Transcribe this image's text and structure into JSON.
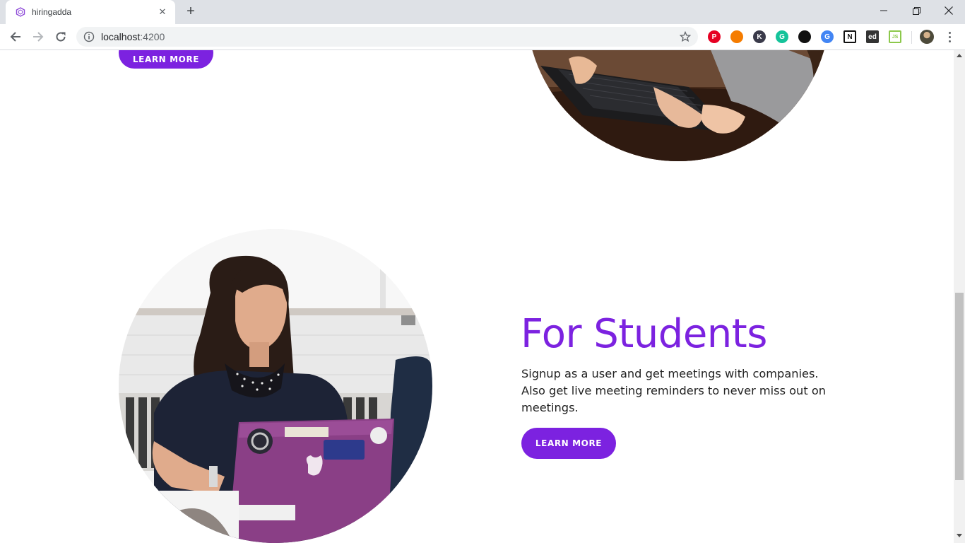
{
  "browser": {
    "tab_title": "hiringadda",
    "url_host": "localhost",
    "url_port": ":4200",
    "extensions": [
      {
        "name": "pinterest-extension-icon",
        "color": "#e60023",
        "letter": "P"
      },
      {
        "name": "orange-blue-extension-icon",
        "color": "#f57c00",
        "letter": ""
      },
      {
        "name": "k-extension-icon",
        "color": "#3a3a4a",
        "letter": "K"
      },
      {
        "name": "grammarly-extension-icon",
        "color": "#15c39a",
        "letter": "G"
      },
      {
        "name": "bird-extension-icon",
        "color": "#111111",
        "letter": ""
      },
      {
        "name": "google-translate-extension-icon",
        "color": "#4285f4",
        "letter": "G"
      },
      {
        "name": "notion-extension-icon",
        "color": "#111111",
        "letter": "N"
      },
      {
        "name": "ed-extension-icon",
        "color": "#333333",
        "letter": "ed"
      },
      {
        "name": "nodejs-extension-icon",
        "color": "#8cc84b",
        "letter": "JS"
      }
    ]
  },
  "page": {
    "top_section": {
      "learn_more_label": "LEARN MORE"
    },
    "students_section": {
      "heading": "For Students",
      "description": "Signup as a user and get meetings with companies. Also get live meeting reminders to never miss out on meetings.",
      "learn_more_label": "LEARN MORE"
    }
  },
  "colors": {
    "accent": "#7c22e0",
    "chrome_bg": "#dee1e6"
  }
}
